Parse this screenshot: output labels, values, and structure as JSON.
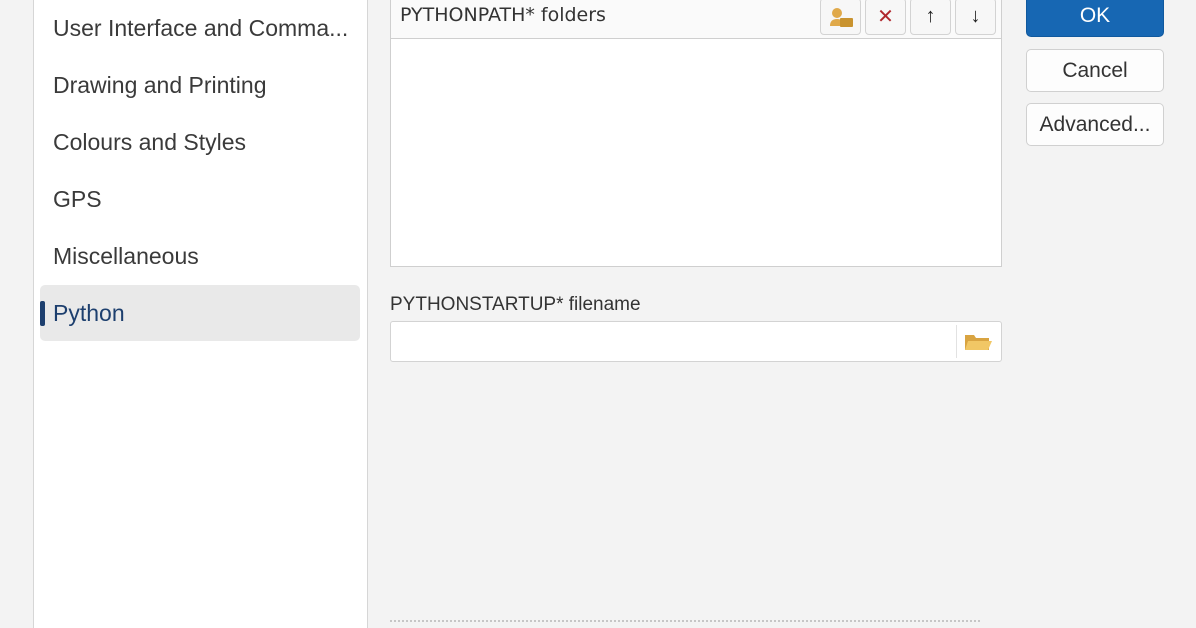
{
  "sidebar": {
    "items": [
      {
        "label": "User Interface and Comma..."
      },
      {
        "label": "Drawing and Printing"
      },
      {
        "label": "Colours and Styles"
      },
      {
        "label": "GPS"
      },
      {
        "label": "Miscellaneous"
      },
      {
        "label": "Python",
        "selected": true
      }
    ]
  },
  "pythonpath": {
    "label": "PYTHONPATH* folders",
    "toolbar": {
      "add_icon": "add-folder-icon",
      "remove_icon": "delete-x-icon",
      "up_icon": "arrow-up-icon",
      "down_icon": "arrow-down-icon",
      "remove_glyph": "✕",
      "up_glyph": "↑",
      "down_glyph": "↓"
    },
    "items": []
  },
  "pythonstartup": {
    "label": "PYTHONSTARTUP* filename",
    "value": "",
    "browse_icon": "folder-open-icon"
  },
  "buttons": {
    "ok": "OK",
    "cancel": "Cancel",
    "advanced": "Advanced..."
  },
  "colors": {
    "accent": "#1767b3",
    "selected_text": "#1d3f6e",
    "delete_icon": "#b0272d",
    "folder_icon": "#e5b254"
  }
}
